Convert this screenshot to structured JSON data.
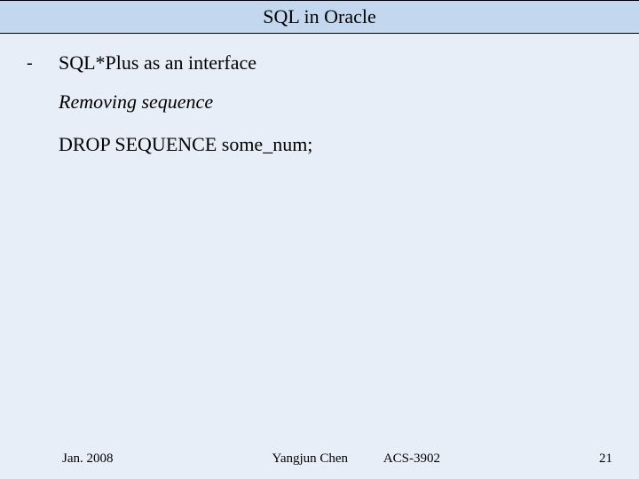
{
  "header": {
    "title": "SQL in Oracle"
  },
  "content": {
    "bullet_dash": "-",
    "bullet_text": "SQL*Plus as an interface",
    "subheading": "Removing sequence",
    "code_line": "DROP SEQUENCE some_num;"
  },
  "footer": {
    "date": "Jan. 2008",
    "author": "Yangjun Chen",
    "course": "ACS-3902",
    "page": "21"
  }
}
